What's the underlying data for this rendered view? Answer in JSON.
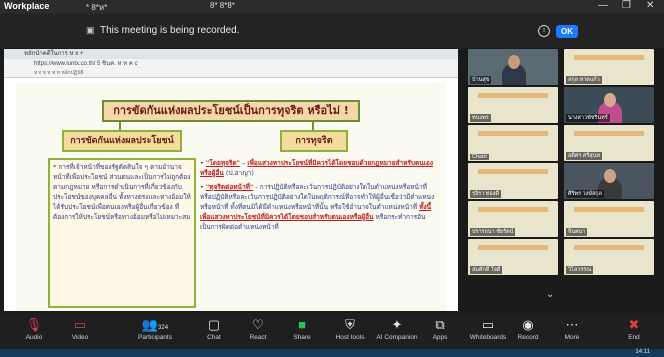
{
  "window": {
    "title": "Workplace",
    "tab1": "* 8*ห*",
    "tab2": "8* 8*8*"
  },
  "recording": {
    "message": "This meeting is being recorded.",
    "ok_label": "OK",
    "info_glyph": "i"
  },
  "browser": {
    "tab_title": "หลักนำคดีในการ ห x +",
    "address": "https://www.luntx.co.th/ 5 ชินค. ห ห ค c",
    "bookmarks": "ห x ห ห ห ห หลักปฏิบัติ"
  },
  "slide": {
    "title": "การขัดกันแห่งผลประโยชน์เป็นการทุจริต หรือไม่ !",
    "left_heading": "การขัดกันแห่งผลประโยชน์",
    "right_heading": "การทุจริต",
    "left_text": "* การที่เจ้าหน้าที่ของรัฐตัดสินใจ ๆ ตามอำนาจหน้าที่เพื่อประโยชน์ ส่วนตนและเป็นการไม่ถูกต้องตามกฎหมาย หรือการดำเนินการที่เกี่ยวข้องกับประโยชน์ของบุคคลอื่น ทั้งทางตรงและทางอ้อมให้ได้รับประโยชน์เพื่อตนเองหรือผู้อื่นเกี่ยวข้อง ที่ต้องการให้ประโยชน์หรือทางอ้อมหรือไม่เหมาะสม",
    "right_p1_label": "\"โดยทุจริต\"",
    "right_p1_hl": "เพื่อแสวงหาประโยชน์ที่มิควรได้โดยชอบด้วยกฎหมายสำหรับตนเองหรือผู้อื่น",
    "right_p1_ref": "(ป.อาญา)",
    "right_p2_label": "\"ทุจริตต่อหน้าที่\"",
    "right_p2_text": "- การปฏิบัติหรือละเว้นการปฏิบัติอย่างใดในตำแหน่งหรือหน้าที่ หรือปฏิบัติหรือละเว้นการปฏิบัติอย่างใดในพฤติการณ์ที่อาจทำให้ผู้อื่นเชื่อว่ามีตำแหน่งหรือหน้าที่ ทั้งที่ตนมิได้มีตำแหน่งหรือหน้าที่นั้น หรือใช้อำนาจในตำแหน่งหน้าที่",
    "right_p2_hl": "ทั้งนี้ เพื่อแสวงหาประโยชน์ที่มิควรได้โดยชอบสำหรับตนเองหรือผู้อื่น",
    "right_p2_tail": "หรือกระทำการอันเป็นการผิดต่อตำแหน่งหน้าที่"
  },
  "gallery": {
    "tiles": [
      {
        "name": "บ้านสุข",
        "kind": "person",
        "bg": "#5a6a72",
        "skin": "#c79a7a",
        "cloth": "#2f3848"
      },
      {
        "name": "สกุล หาดแก้ว",
        "kind": "slide"
      },
      {
        "name": "ทนงพร",
        "kind": "slide"
      },
      {
        "name": "นางสาวพัชรินทร์",
        "kind": "person",
        "bg": "#3c4a55",
        "skin": "#d6a98e",
        "cloth": "#c04b8f"
      },
      {
        "name": "Chatri",
        "kind": "slide"
      },
      {
        "name": "อดิศร ศรีสุนท",
        "kind": "slide"
      },
      {
        "name": "รุจิรา ทองดี",
        "kind": "slide"
      },
      {
        "name": "ศิริพร วงษ์สกุล",
        "kind": "person",
        "bg": "#4b5560",
        "skin": "#cfa285",
        "cloth": "#3a3a3a"
      },
      {
        "name": "ปรารถนา ชัยรัตน์",
        "kind": "slide"
      },
      {
        "name": "จินตนา",
        "kind": "slide"
      },
      {
        "name": "สมศักดิ์ ใจดี",
        "kind": "slide"
      },
      {
        "name": "วิไลวรรณ",
        "kind": "slide"
      }
    ]
  },
  "toolbar": {
    "audio": "Audio",
    "video": "Video",
    "participants": "Participants",
    "participants_count": "324",
    "chat": "Chat",
    "react": "React",
    "share": "Share",
    "host_tools": "Host tools",
    "ai_companion": "AI Companion",
    "apps": "Apps",
    "whiteboards": "Whiteboards",
    "record": "Record",
    "more": "More",
    "end": "End"
  },
  "taskbar": {
    "clock": "14:11"
  },
  "colors": {
    "accent": "#1b7bff",
    "end": "#e23b3b",
    "share": "#27c45a",
    "slide_title_bg": "#f6d8a8",
    "slide_border": "#8fb03a"
  }
}
